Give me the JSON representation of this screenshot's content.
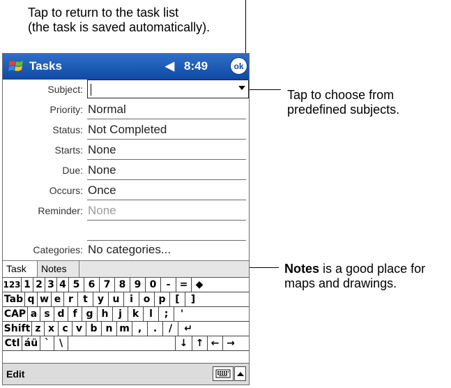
{
  "callouts": {
    "top_line1": "Tap to return to the task list",
    "top_line2": "(the task is saved automatically).",
    "subject_line1": "Tap to choose from",
    "subject_line2": "predefined subjects.",
    "notes_bold": "Notes",
    "notes_rest": " is a good place for",
    "notes_line2": "maps and drawings."
  },
  "titlebar": {
    "app_title": "Tasks",
    "speaker": "◀",
    "clock": "8:49",
    "ok": "ok"
  },
  "form": {
    "subject_label": "Subject:",
    "subject_value": "",
    "fields": [
      {
        "label": "Priority:",
        "value": "Normal"
      },
      {
        "label": "Status:",
        "value": "Not Completed"
      },
      {
        "label": "Starts:",
        "value": "None"
      },
      {
        "label": "Due:",
        "value": "None"
      },
      {
        "label": "Occurs:",
        "value": "Once"
      },
      {
        "label": "Reminder:",
        "value": "None"
      },
      {
        "label": "Categories:",
        "value": "No categories..."
      }
    ]
  },
  "tabs": {
    "task": "Task",
    "notes": "Notes"
  },
  "keyboard": {
    "row1": [
      "123",
      "1",
      "2",
      "3",
      "4",
      "5",
      "6",
      "7",
      "8",
      "9",
      "0",
      "-",
      "=",
      "◆"
    ],
    "row2": [
      "Tab",
      "q",
      "w",
      "e",
      "r",
      "t",
      "y",
      "u",
      "i",
      "o",
      "p",
      "[",
      "]"
    ],
    "row3": [
      "CAP",
      "a",
      "s",
      "d",
      "f",
      "g",
      "h",
      "j",
      "k",
      "l",
      ";",
      "'"
    ],
    "row4": [
      "Shift",
      "z",
      "x",
      "c",
      "v",
      "b",
      "n",
      "m",
      ",",
      ".",
      "/",
      "↵"
    ],
    "row5": [
      "Ctl",
      "áü",
      "`",
      "\\",
      "",
      "↓",
      "↑",
      "←",
      "→"
    ]
  },
  "bottombar": {
    "edit": "Edit"
  },
  "icons": {
    "start": "windows-flag-icon",
    "speaker": "speaker-icon",
    "dropdown": "chevron-down-icon",
    "keyboard": "keyboard-icon",
    "up": "chevron-up-icon"
  }
}
